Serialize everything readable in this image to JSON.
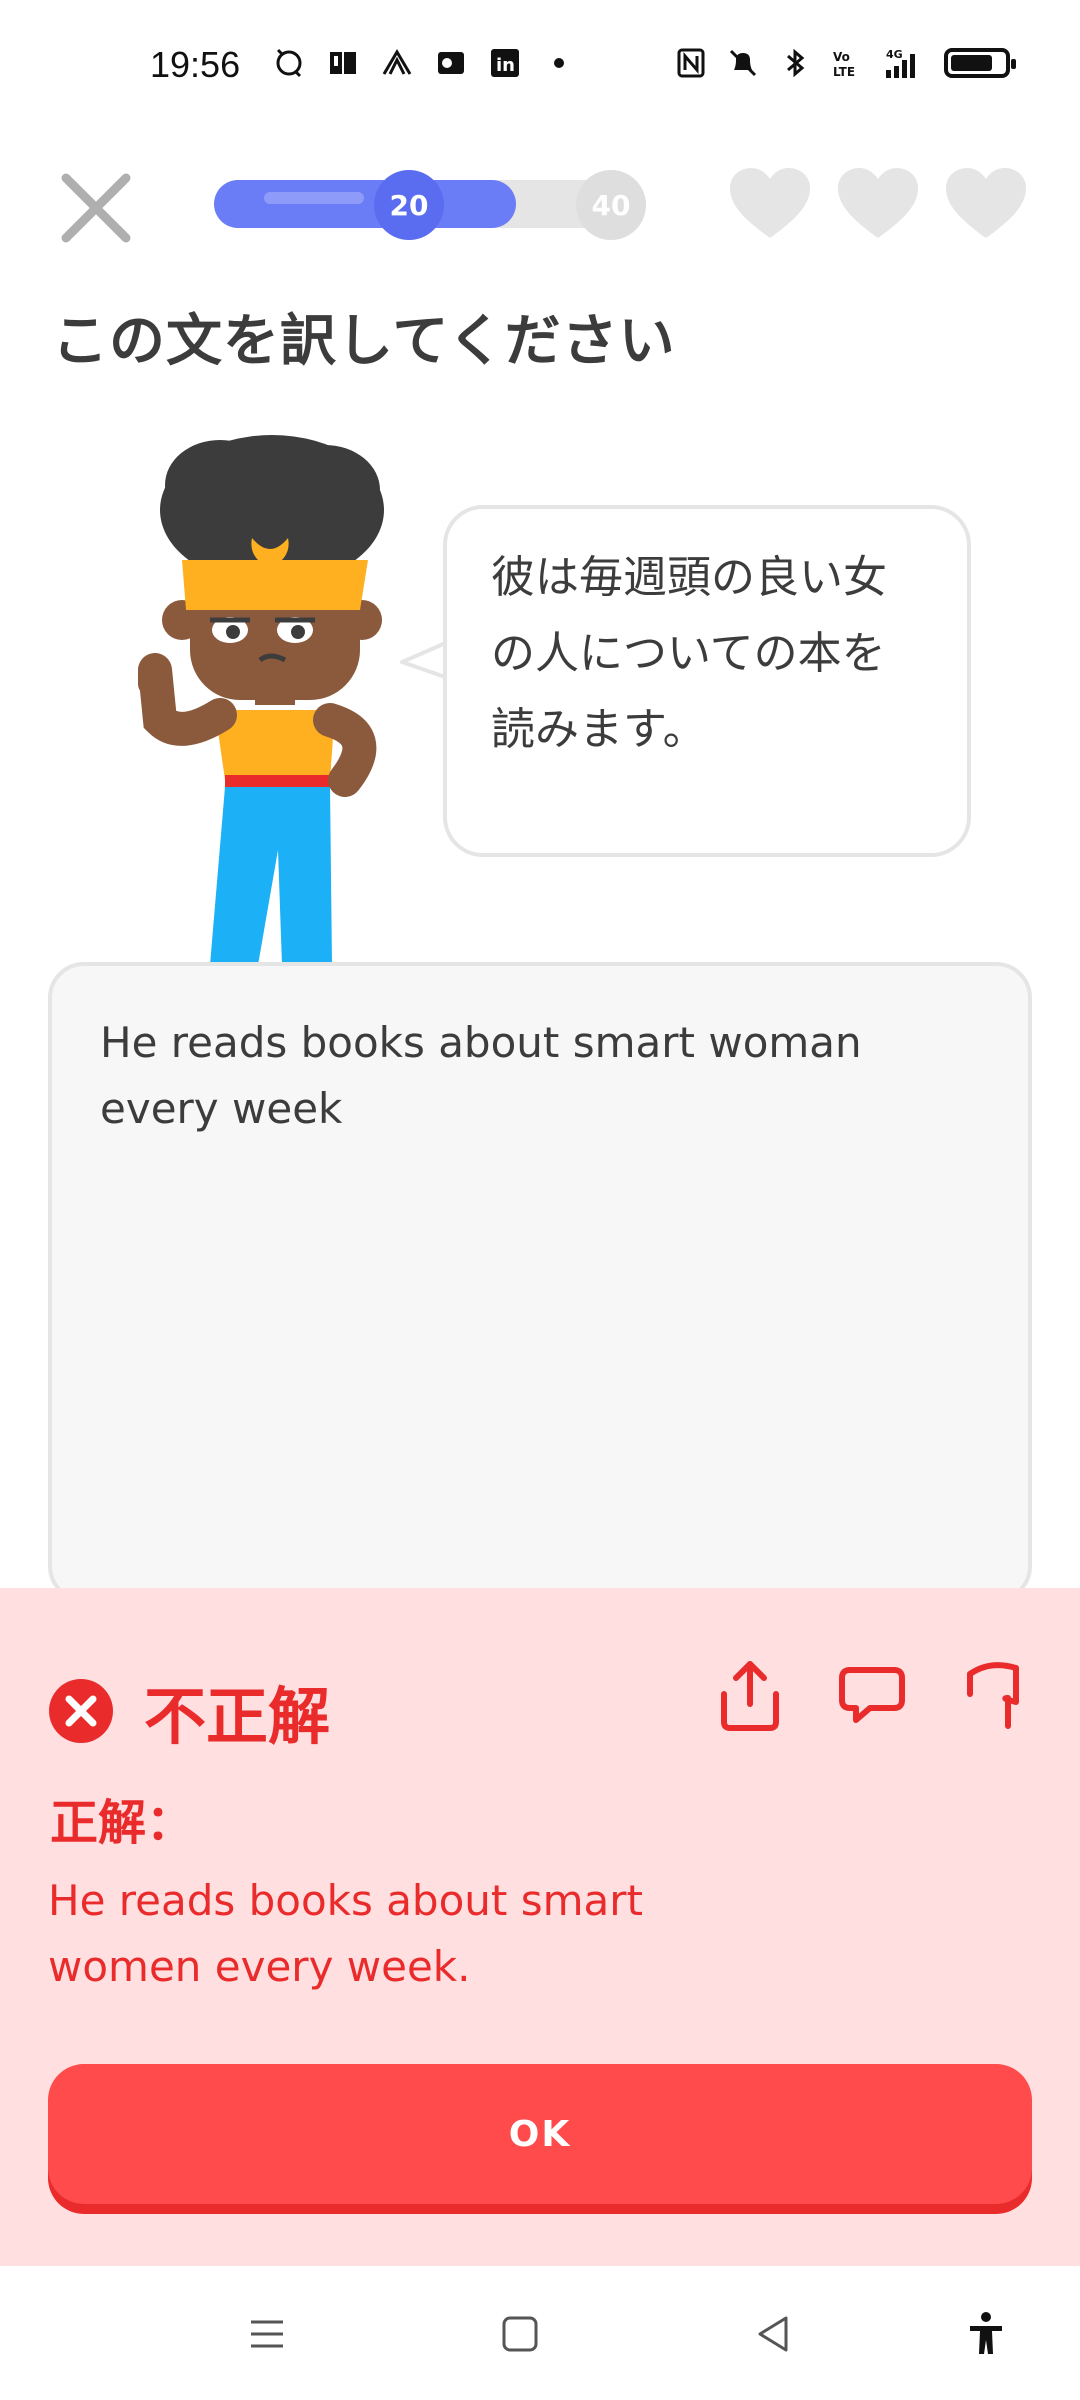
{
  "status_bar": {
    "time": "19:56",
    "left_icons": [
      "sync-icon",
      "book-icon",
      "leaf-icon",
      "outlook-icon",
      "linkedin-icon",
      "dot"
    ],
    "right_icons": [
      "nfc-icon",
      "mute-icon",
      "bluetooth-icon",
      "volte-icon",
      "signal-4g-icon",
      "battery-icon"
    ]
  },
  "header": {
    "progress_value": 20,
    "progress_next": 40,
    "progress_fraction": 0.5,
    "hearts_count": 3,
    "heart_color": "#e5e5e5",
    "progress_color": "#6a7cf6"
  },
  "exercise": {
    "instruction": "この文を訳してください",
    "bubble_lines": [
      "彼は毎週頭の良い女",
      "の人についての本を",
      "読みます。"
    ],
    "user_answer": "He reads books about smart woman every week"
  },
  "feedback": {
    "title": "不正解",
    "label": "正解：",
    "correct_answer": "He reads books about smart women every week.",
    "button_label": "OK",
    "accent_color": "#ea2b2b",
    "background_color": "#ffdfe0"
  },
  "nav_bar": {
    "icons": [
      "menu-icon",
      "home-icon",
      "back-icon",
      "accessibility-icon"
    ]
  }
}
